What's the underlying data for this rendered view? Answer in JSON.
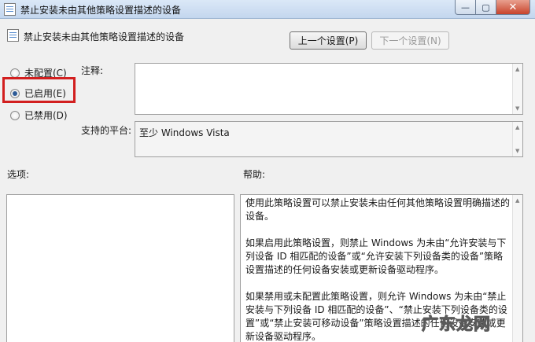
{
  "window": {
    "title": "禁止安装未由其他策略设置描述的设备",
    "min_symbol": "—",
    "max_symbol": "▢",
    "close_symbol": "✕"
  },
  "header": {
    "policy_title": "禁止安装未由其他策略设置描述的设备",
    "prev_label": "上一个设置(P)",
    "next_label": "下一个设置(N)"
  },
  "radios": [
    {
      "label": "未配置(C)",
      "checked": false
    },
    {
      "label": "已启用(E)",
      "checked": true
    },
    {
      "label": "已禁用(D)",
      "checked": false
    }
  ],
  "comment_label": "注释:",
  "platform_label": "支持的平台:",
  "platform_value": "至少 Windows Vista",
  "options_label": "选项:",
  "help_label": "帮助:",
  "help": [
    "使用此策略设置可以禁止安装未由任何其他策略设置明确描述的设备。",
    "如果启用此策略设置，则禁止 Windows 为未由“允许安装与下列设备 ID 相匹配的设备”或“允许安装下列设备类的设备”策略设置描述的任何设备安装或更新设备驱动程序。",
    "如果禁用或未配置此策略设置，则允许 Windows 为未由“禁止安装与下列设备 ID 相匹配的设备”、“禁止安装下列设备类的设置”或“禁止安装可移动设备”策略设置描述的任何设备安装或更新设备驱动程序。"
  ],
  "watermark": "广东龙网",
  "colors": {
    "highlight_box": "#d21f1f"
  }
}
